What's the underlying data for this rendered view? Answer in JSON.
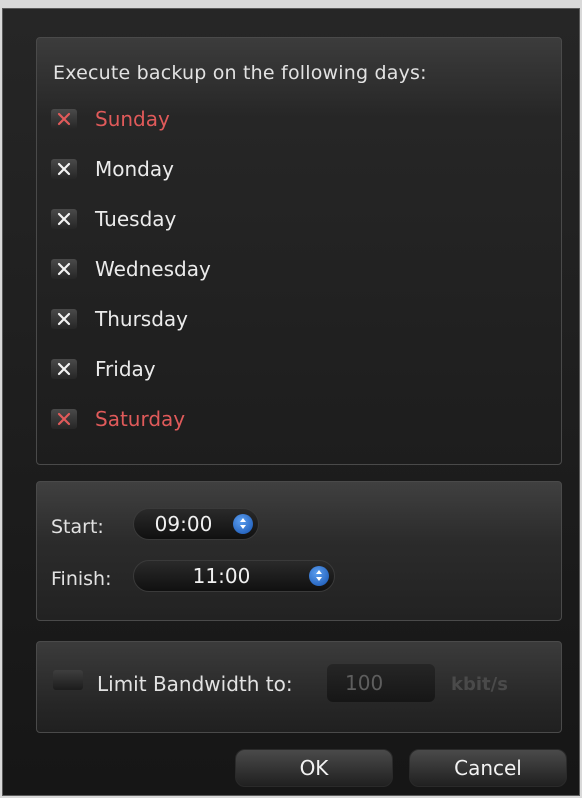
{
  "schedule": {
    "heading": "Execute backup on the following days:",
    "days": [
      {
        "label": "Sunday",
        "weekend": true
      },
      {
        "label": "Monday",
        "weekend": false
      },
      {
        "label": "Tuesday",
        "weekend": false
      },
      {
        "label": "Wednesday",
        "weekend": false
      },
      {
        "label": "Thursday",
        "weekend": false
      },
      {
        "label": "Friday",
        "weekend": false
      },
      {
        "label": "Saturday",
        "weekend": true
      }
    ],
    "checked_icon": "x-mark-icon",
    "weekday_color": "#ebebeb",
    "weekend_color": "#e05a5a"
  },
  "time": {
    "start_label": "Start:",
    "start_value": "09:00",
    "finish_label": "Finish:",
    "finish_value": "11:00",
    "spinner_icon": "up-down-arrows-icon",
    "accent": "#2a6fd6"
  },
  "bandwidth": {
    "checked": false,
    "label": "Limit Bandwidth to:",
    "value": "100",
    "unit": "kbit/s"
  },
  "buttons": {
    "ok": "OK",
    "cancel": "Cancel"
  }
}
